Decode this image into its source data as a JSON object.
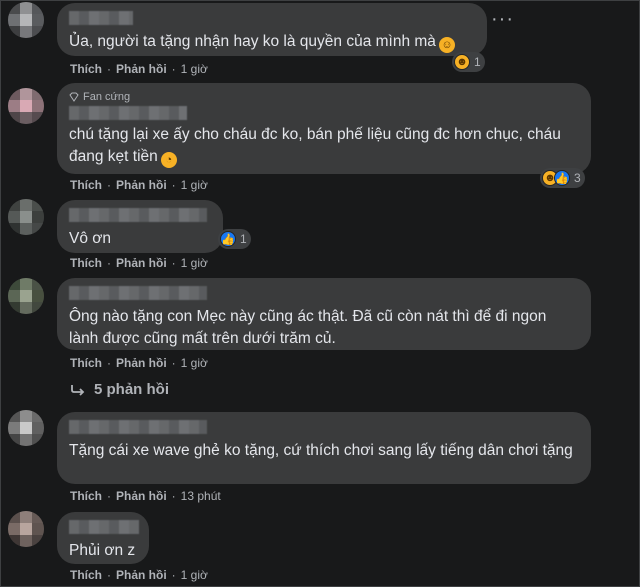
{
  "comments": [
    {
      "text": "Ủa, người ta tặng nhận hay ko là quyền của mình mà",
      "like_label": "Thích",
      "reply_label": "Phản hồi",
      "time": "1 giờ",
      "reaction_count": "1"
    },
    {
      "badge": "Fan cứng",
      "text": "chú tặng lại xe ấy cho cháu đc ko, bán phế liệu cũng đc hơn chục, cháu đang kẹt tiền",
      "like_label": "Thích",
      "reply_label": "Phản hồi",
      "time": "1 giờ",
      "reaction_count": "3"
    },
    {
      "text": "Vô ơn",
      "like_label": "Thích",
      "reply_label": "Phản hồi",
      "time": "1 giờ",
      "reaction_count": "1"
    },
    {
      "text": "Ông nào tặng con Mẹc này cũng ác thật. Đã cũ còn nát thì để đi ngon lành được cũng mất trên dưới trăm củ.",
      "like_label": "Thích",
      "reply_label": "Phản hồi",
      "time": "1 giờ"
    },
    {
      "text": "Tặng cái xe wave ghẻ ko tặng, cứ thích chơi sang lấy tiếng dân chơi tặng",
      "like_label": "Thích",
      "reply_label": "Phản hồi",
      "time": "13 phút"
    },
    {
      "text": "Phủi ơn z",
      "like_label": "Thích",
      "reply_label": "Phản hồi",
      "time": "1 giờ"
    }
  ],
  "view_replies": "5 phản hồi",
  "colors": {
    "background": "#18191a",
    "bubble": "#3a3b3c",
    "meta": "#b0b3b8",
    "like": "#1877f2",
    "haha": "#f7b125"
  }
}
